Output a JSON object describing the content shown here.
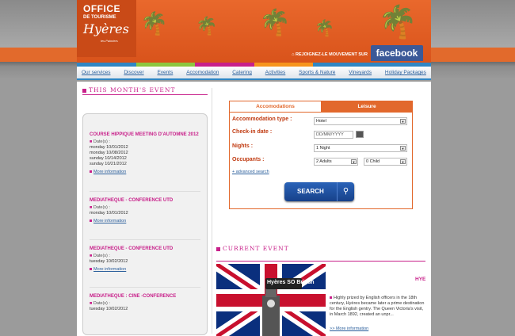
{
  "header": {
    "logo": {
      "line1": "OFFICE",
      "line2": "DE TOURISME",
      "line3": "Hyères",
      "line4": "les Palmiers"
    },
    "facebook_text": "REJOIGNEZ-LE MOUVEMENT SUR",
    "facebook_label": "facebook",
    "colors": {
      "orange": "#e26a2c",
      "blue": "#2f86c4",
      "pink": "#c8208a"
    },
    "colorbar": [
      "#2f86c4",
      "#8dc63f",
      "#c8208a",
      "#f7941d",
      "#2f86c4",
      "#2f86c4"
    ]
  },
  "nav": [
    "Our services",
    "Discover",
    "Events",
    "Accomodation",
    "Catering",
    "Activities",
    "Sports & Nature",
    "Vineyards",
    "Holiday Packages"
  ],
  "month_event": {
    "title": "This month's event",
    "events": [
      {
        "title": "COURSE HIPPIQUE MEETING D'AUTOMNE 2012",
        "dates_label": "Date(s) :",
        "dates": [
          "monday 10/01/2012",
          "monday 10/08/2012",
          "sunday 10/14/2012",
          "sunday 10/21/2012"
        ],
        "more": "More information"
      },
      {
        "title": "MEDIATHEQUE - CONFERENCE UTD",
        "dates_label": "Date(s) :",
        "dates": [
          "monday 10/01/2012"
        ],
        "more": "More information"
      },
      {
        "title": "MEDIATHEQUE - CONFERENCE UTD",
        "dates_label": "Date(s) :",
        "dates": [
          "tuesday 10/02/2012"
        ],
        "more": "More information"
      },
      {
        "title": "MEDIATHEQUE : CINE -CONFERENCE",
        "dates_label": "Date(s) :",
        "dates": [
          "tuesday 10/02/2012"
        ],
        "more": ""
      }
    ]
  },
  "search": {
    "tabs": [
      "Accomodations",
      "Leisure"
    ],
    "accommodation_label": "Accommodation type :",
    "accommodation_value": "Hotel",
    "checkin_label": "Check-in date :",
    "checkin_placeholder": "DD/MM/YYYY",
    "nights_label": "Nights :",
    "nights_value": "1 Night",
    "occupants_label": "Occupants :",
    "adults_value": "2 Adults",
    "children_value": "0 Child",
    "advanced": "+ advanced search",
    "button": "SEARCH"
  },
  "current_event": {
    "title": "Current event",
    "image_caption": "Hyères SO British",
    "hye": "HYE",
    "text": "Highly prized by English officers in the 18th century, Hyères became later a prime destination for the English gentry. The Queen Victoria's visit, in March 1892, created an unpr...",
    "more": ">> More information"
  }
}
